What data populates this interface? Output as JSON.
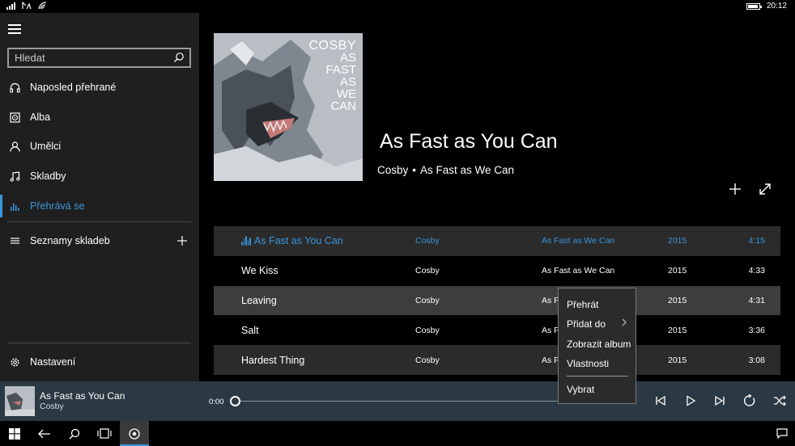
{
  "status_bar": {
    "time": "20:12"
  },
  "sidebar": {
    "search_placeholder": "Hledat",
    "items": [
      {
        "label": "Naposled přehrané",
        "icon": "headphones-icon"
      },
      {
        "label": "Alba",
        "icon": "album-icon"
      },
      {
        "label": "Umělci",
        "icon": "person-icon"
      },
      {
        "label": "Skladby",
        "icon": "music-note-icon"
      },
      {
        "label": "Přehrává se",
        "icon": "equalizer-icon",
        "active": true
      }
    ],
    "playlists_label": "Seznamy skladeb",
    "settings_label": "Nastavení"
  },
  "album": {
    "cover_text": [
      "COSBY",
      "AS",
      "FAST",
      "AS",
      "WE",
      "CAN"
    ],
    "song_title": "As Fast as You Can",
    "artist": "Cosby",
    "separator": "•",
    "album_name": "As Fast as We Can"
  },
  "tracks": [
    {
      "title": "As Fast as You Can",
      "artist": "Cosby",
      "album": "As Fast as We Can",
      "year": "2015",
      "duration": "4:15"
    },
    {
      "title": "We Kiss",
      "artist": "Cosby",
      "album": "As Fast as We Can",
      "year": "2015",
      "duration": "4:33"
    },
    {
      "title": "Leaving",
      "artist": "Cosby",
      "album": "As Fa",
      "year": "2015",
      "duration": "4:31"
    },
    {
      "title": "Salt",
      "artist": "Cosby",
      "album": "As Fa",
      "year": "2015",
      "duration": "3:36"
    },
    {
      "title": "Hardest Thing",
      "artist": "Cosby",
      "album": "As Fa",
      "year": "2015",
      "duration": "3:08"
    }
  ],
  "context_menu": {
    "play": "Přehrát",
    "add_to": "Přidat do",
    "show_album": "Zobrazit album",
    "properties": "Vlastnosti",
    "select": "Vybrat"
  },
  "now_playing": {
    "title": "As Fast as You Can",
    "artist": "Cosby",
    "elapsed": "0:00",
    "progress": 0
  },
  "colors": {
    "accent": "#3a96dd",
    "sidebar_bg": "#1f1f1f",
    "nowbar_bg": "#2b3944",
    "row_alt_bg": "#2b2b2b"
  }
}
